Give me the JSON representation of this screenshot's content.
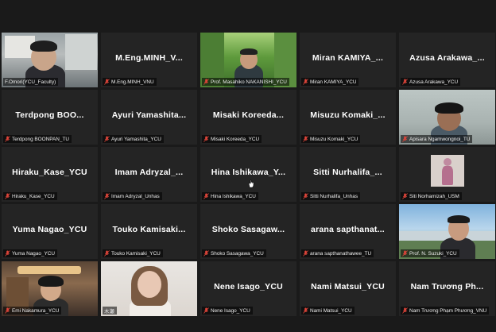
{
  "participants": [
    {
      "center_name": "",
      "label": "F.Omori(YCU_Faculty)",
      "muted": false
    },
    {
      "center_name": "M.Eng.MINH_V...",
      "label": "M.Eng.MINH_VNU",
      "muted": true
    },
    {
      "center_name": "",
      "label": "Prof. Masahiko NAKANISHI_YCU",
      "muted": true,
      "active": true
    },
    {
      "center_name": "Miran KAMIYA_...",
      "label": "Miran KAMIYA_YCU",
      "muted": true
    },
    {
      "center_name": "Azusa Arakawa_...",
      "label": "Azusa Arakawa_YCU",
      "muted": true
    },
    {
      "center_name": "Terdpong BOO...",
      "label": "Terdpong BOONPAN_TU",
      "muted": true
    },
    {
      "center_name": "Ayuri Yamashita...",
      "label": "Ayuri Yamashita_YCU",
      "muted": true
    },
    {
      "center_name": "Misaki Koreeda...",
      "label": "Misaki Koreeda_YCU",
      "muted": true
    },
    {
      "center_name": "Misuzu Komaki_...",
      "label": "Misuzu Komaki_YCU",
      "muted": true
    },
    {
      "center_name": "",
      "label": "Apisara Ngamwongnoi_TU",
      "muted": true
    },
    {
      "center_name": "Hiraku_Kase_YCU",
      "label": "Hiraku_Kase_YCU",
      "muted": true
    },
    {
      "center_name": "Imam Adryzal_...",
      "label": "Imam Adryzal_Unhas",
      "muted": true
    },
    {
      "center_name": "Hina Ishikawa_Y...",
      "label": "Hina Ishikawa_YCU",
      "muted": true
    },
    {
      "center_name": "Sitti Nurhalifa_...",
      "label": "Sitti Nurhalifa_Unhas",
      "muted": true
    },
    {
      "center_name": "",
      "label": "Siti Norhamizah_USM",
      "muted": true
    },
    {
      "center_name": "Yuma Nagao_YCU",
      "label": "Yuma Nagao_YCU",
      "muted": true
    },
    {
      "center_name": "Touko Kamisaki...",
      "label": "Touko Kamisaki_YCU",
      "muted": true
    },
    {
      "center_name": "Shoko Sasagaw...",
      "label": "Shoko Sasagawa_YCU",
      "muted": true
    },
    {
      "center_name": "arana sapthanat...",
      "label": "arana sapthanathawee_TU",
      "muted": true
    },
    {
      "center_name": "",
      "label": "Prof. N. Suzuki_YCU",
      "muted": true
    },
    {
      "center_name": "",
      "label": "Emi Nakamura_YCU",
      "muted": true
    },
    {
      "center_name": "",
      "label": "木瀬",
      "muted": false
    },
    {
      "center_name": "Nene Isago_YCU",
      "label": "Nene Isago_YCU",
      "muted": true
    },
    {
      "center_name": "Nami Matsui_YCU",
      "label": "Nami Matsui_YCU",
      "muted": true
    },
    {
      "center_name": "Nam Trương Ph...",
      "label": "Nam Trương Phạm Phương_VNU",
      "muted": true
    }
  ],
  "colors": {
    "mute_red": "#e0453a",
    "active_border": "#c8e25a"
  }
}
